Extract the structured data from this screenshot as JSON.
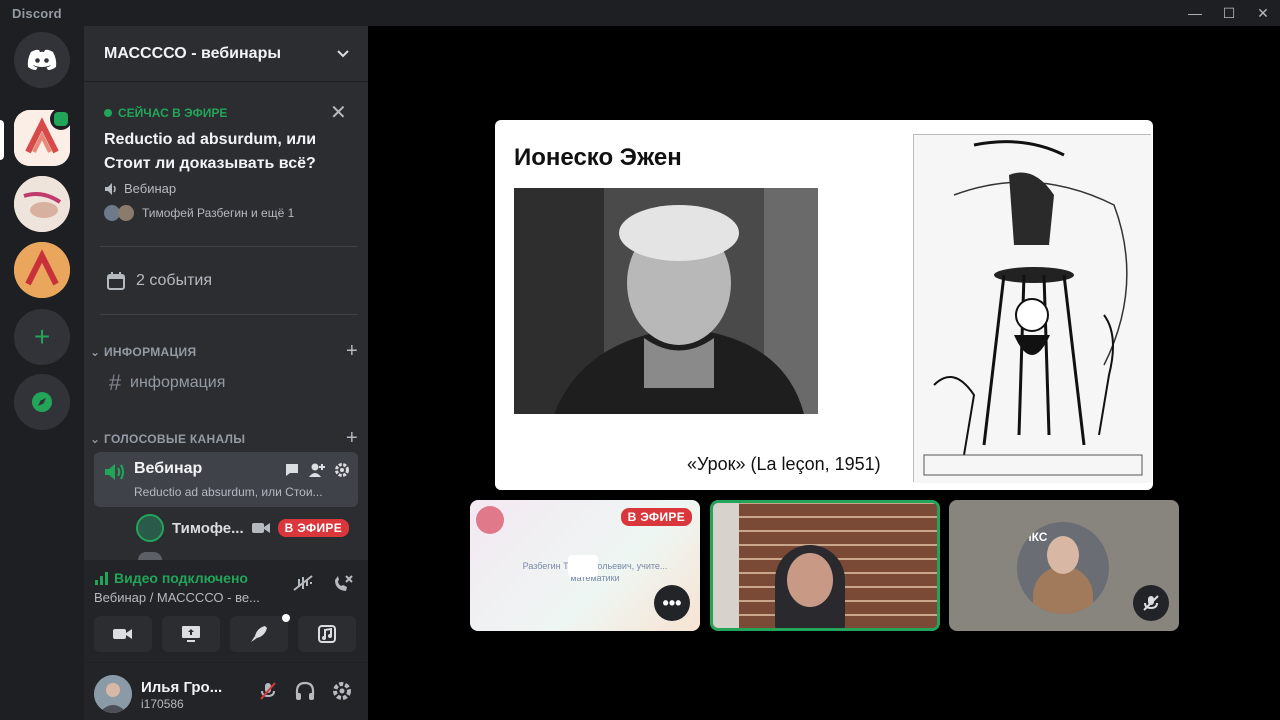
{
  "titlebar": {
    "app_name": "Discord"
  },
  "server": {
    "name": "МАССССО - вебинары"
  },
  "live_event": {
    "status": "СЕЙЧАС В ЭФИРЕ",
    "title": "Reductio ad absurdum, или Стоит ли доказывать всё?",
    "type": "Вебинар",
    "participants": "Тимофей Разбегин и ещё 1"
  },
  "events": {
    "label": "2 события"
  },
  "categories": {
    "info": "ИНФОРМАЦИЯ",
    "voice": "ГОЛОСОВЫЕ КАНАЛЫ"
  },
  "channels": {
    "info": "информация",
    "voice_name": "Вебинар",
    "voice_sub": "Reductio ad absurdum, или Стои..."
  },
  "voice_user": {
    "name": "Тимофе...",
    "live_tag": "В ЭФИРЕ"
  },
  "rtc": {
    "status": "Видео подключено",
    "location": "Вебинар / МАССССО - ве..."
  },
  "user": {
    "name": "Илья Гро...",
    "tag": "i170586"
  },
  "slide": {
    "title": "Ионеско Эжен",
    "caption": "«Урок» (La leçon, 1951)"
  },
  "tiles": {
    "t1_live_tag": "В ЭФИРЕ",
    "t1_text": "Разбегин Т... Анатольевич, учите... математики",
    "t1_more": "•••",
    "t3_text": "ИКС"
  },
  "colors": {
    "accent_green": "#23a559",
    "live_red": "#da373c",
    "sidebar_bg": "#2b2d31",
    "rail_bg": "#1e1f22"
  }
}
